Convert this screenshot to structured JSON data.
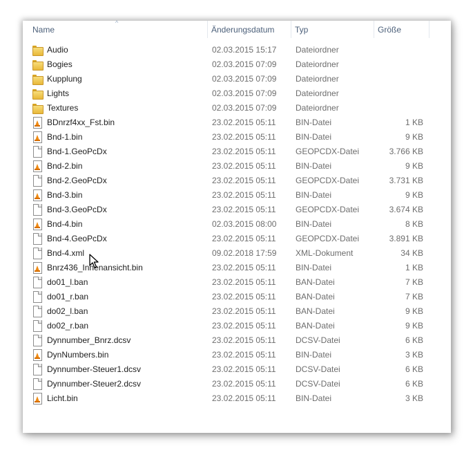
{
  "columns": {
    "name": "Name",
    "date": "Änderungsdatum",
    "type": "Typ",
    "size": "Größe"
  },
  "files": [
    {
      "name": "Audio",
      "date": "02.03.2015 15:17",
      "type": "Dateiordner",
      "size": "",
      "icon": "folder-icon"
    },
    {
      "name": "Bogies",
      "date": "02.03.2015 07:09",
      "type": "Dateiordner",
      "size": "",
      "icon": "folder-icon"
    },
    {
      "name": "Kupplung",
      "date": "02.03.2015 07:09",
      "type": "Dateiordner",
      "size": "",
      "icon": "folder-icon"
    },
    {
      "name": "Lights",
      "date": "02.03.2015 07:09",
      "type": "Dateiordner",
      "size": "",
      "icon": "folder-icon"
    },
    {
      "name": "Textures",
      "date": "02.03.2015 07:09",
      "type": "Dateiordner",
      "size": "",
      "icon": "folder-icon"
    },
    {
      "name": "BDnrzf4xx_Fst.bin",
      "date": "23.02.2015 05:11",
      "type": "BIN-Datei",
      "size": "1 KB",
      "icon": "vlc-file-icon"
    },
    {
      "name": "Bnd-1.bin",
      "date": "23.02.2015 05:11",
      "type": "BIN-Datei",
      "size": "9 KB",
      "icon": "vlc-file-icon"
    },
    {
      "name": "Bnd-1.GeoPcDx",
      "date": "23.02.2015 05:11",
      "type": "GEOPCDX-Datei",
      "size": "3.766 KB",
      "icon": "file-icon"
    },
    {
      "name": "Bnd-2.bin",
      "date": "23.02.2015 05:11",
      "type": "BIN-Datei",
      "size": "9 KB",
      "icon": "vlc-file-icon"
    },
    {
      "name": "Bnd-2.GeoPcDx",
      "date": "23.02.2015 05:11",
      "type": "GEOPCDX-Datei",
      "size": "3.731 KB",
      "icon": "file-icon"
    },
    {
      "name": "Bnd-3.bin",
      "date": "23.02.2015 05:11",
      "type": "BIN-Datei",
      "size": "9 KB",
      "icon": "vlc-file-icon"
    },
    {
      "name": "Bnd-3.GeoPcDx",
      "date": "23.02.2015 05:11",
      "type": "GEOPCDX-Datei",
      "size": "3.674 KB",
      "icon": "file-icon"
    },
    {
      "name": "Bnd-4.bin",
      "date": "02.03.2015 08:00",
      "type": "BIN-Datei",
      "size": "8 KB",
      "icon": "vlc-file-icon"
    },
    {
      "name": "Bnd-4.GeoPcDx",
      "date": "23.02.2015 05:11",
      "type": "GEOPCDX-Datei",
      "size": "3.891 KB",
      "icon": "file-icon"
    },
    {
      "name": "Bnd-4.xml",
      "date": "09.02.2018 17:59",
      "type": "XML-Dokument",
      "size": "34 KB",
      "icon": "file-icon"
    },
    {
      "name": "Bnrz436_Innenansicht.bin",
      "date": "23.02.2015 05:11",
      "type": "BIN-Datei",
      "size": "1 KB",
      "icon": "vlc-file-icon"
    },
    {
      "name": "do01_l.ban",
      "date": "23.02.2015 05:11",
      "type": "BAN-Datei",
      "size": "7 KB",
      "icon": "file-icon"
    },
    {
      "name": "do01_r.ban",
      "date": "23.02.2015 05:11",
      "type": "BAN-Datei",
      "size": "7 KB",
      "icon": "file-icon"
    },
    {
      "name": "do02_l.ban",
      "date": "23.02.2015 05:11",
      "type": "BAN-Datei",
      "size": "9 KB",
      "icon": "file-icon"
    },
    {
      "name": "do02_r.ban",
      "date": "23.02.2015 05:11",
      "type": "BAN-Datei",
      "size": "9 KB",
      "icon": "file-icon"
    },
    {
      "name": "Dynnumber_Bnrz.dcsv",
      "date": "23.02.2015 05:11",
      "type": "DCSV-Datei",
      "size": "6 KB",
      "icon": "file-icon"
    },
    {
      "name": "DynNumbers.bin",
      "date": "23.02.2015 05:11",
      "type": "BIN-Datei",
      "size": "3 KB",
      "icon": "vlc-file-icon"
    },
    {
      "name": "Dynnumber-Steuer1.dcsv",
      "date": "23.02.2015 05:11",
      "type": "DCSV-Datei",
      "size": "6 KB",
      "icon": "file-icon"
    },
    {
      "name": "Dynnumber-Steuer2.dcsv",
      "date": "23.02.2015 05:11",
      "type": "DCSV-Datei",
      "size": "6 KB",
      "icon": "file-icon"
    },
    {
      "name": "Licht.bin",
      "date": "23.02.2015 05:11",
      "type": "BIN-Datei",
      "size": "3 KB",
      "icon": "vlc-file-icon"
    }
  ]
}
